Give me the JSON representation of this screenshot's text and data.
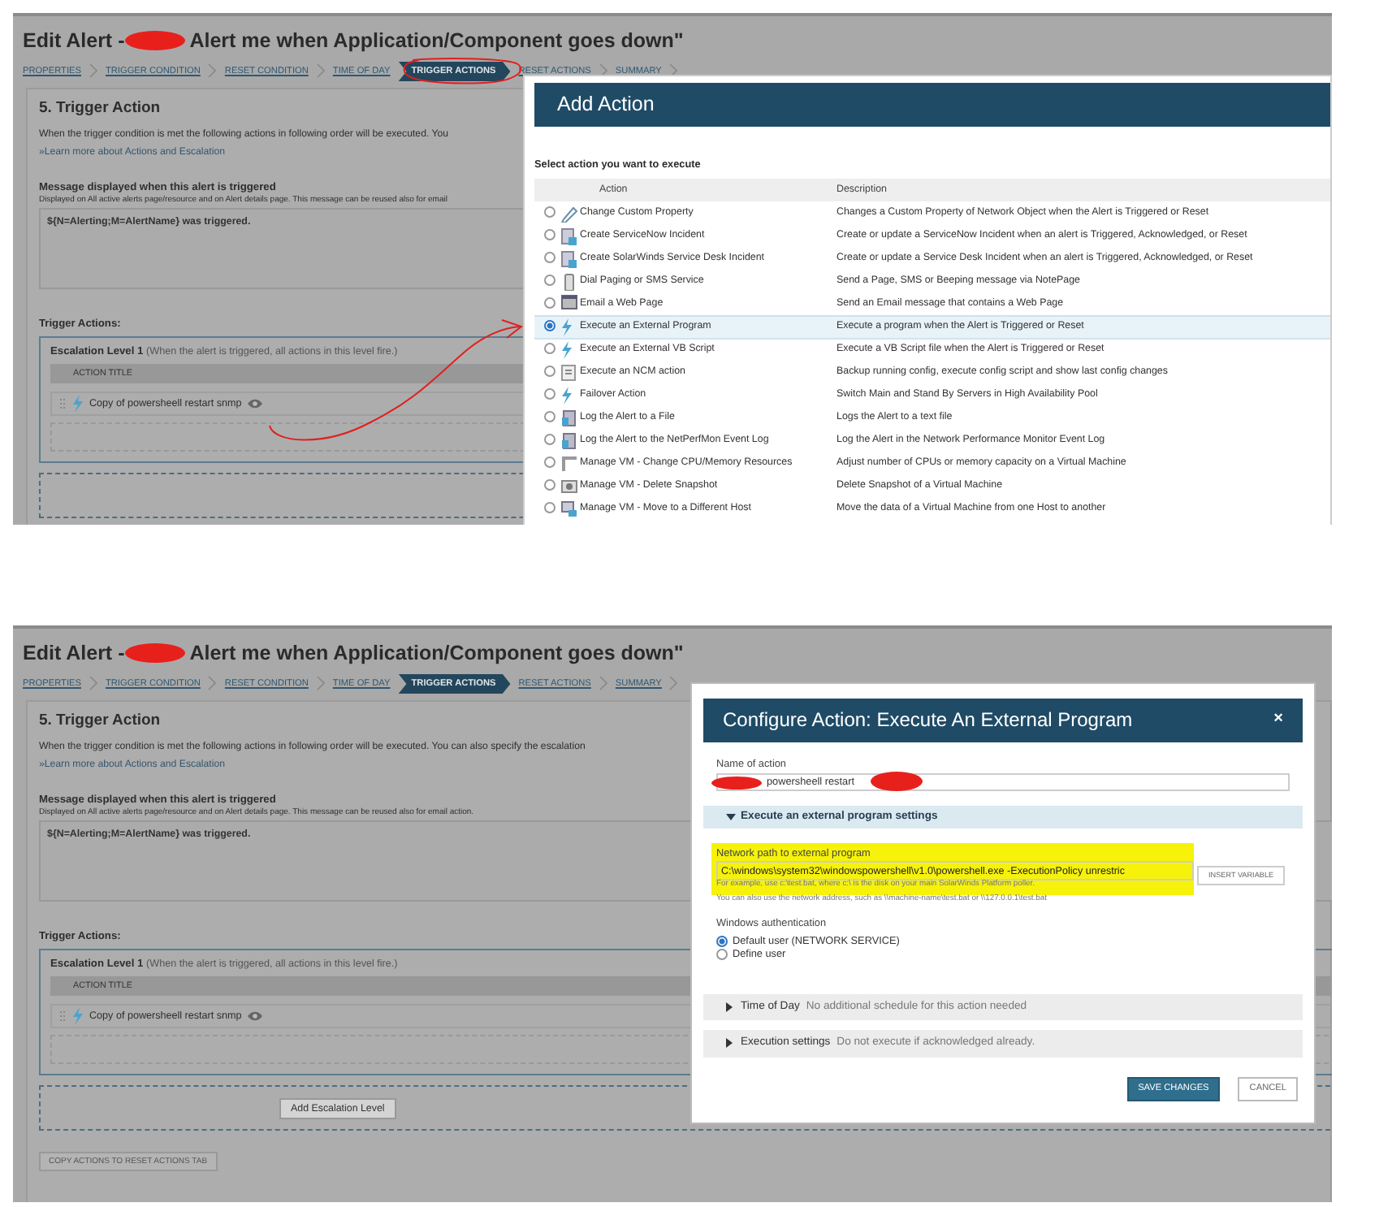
{
  "screens": [
    {
      "title_prefix": "Edit Alert -",
      "title_redacted": true,
      "title": "Alert me when Application/Component goes down\"",
      "steps": [
        {
          "label": "PROPERTIES",
          "selected": false
        },
        {
          "label": "TRIGGER CONDITION",
          "selected": false
        },
        {
          "label": "RESET CONDITION",
          "selected": false
        },
        {
          "label": "TIME OF DAY",
          "selected": false
        },
        {
          "label": "TRIGGER ACTIONS",
          "selected": true
        },
        {
          "label": "RESET ACTIONS",
          "selected": false
        },
        {
          "label": "SUMMARY",
          "selected": false
        }
      ],
      "heading": "5. Trigger Action",
      "intro": "When the trigger condition is met the following actions in following order will be executed. You",
      "learn_more": "»Learn more about Actions and Escalation",
      "message_label": "Message displayed when this alert is triggered",
      "message_hint": "Displayed on All active alerts page/resource and on Alert details page. This message can be reused also for email",
      "message_value": "${N=Alerting;M=AlertName} was triggered.",
      "trigger_actions_label": "Trigger Actions:",
      "escalation": {
        "title": "Escalation Level 1",
        "note": "(When the alert is triggered, all actions in this level fire.)",
        "column": "ACTION TITLE",
        "actions": [
          "Copy of powersheell restart snmp"
        ]
      },
      "dialog": {
        "kind": "add_action",
        "title": "Add Action",
        "prompt": "Select action you want to execute",
        "columns": [
          "Action",
          "Description"
        ],
        "rows": [
          {
            "action": "Change Custom Property",
            "description": "Changes a Custom Property of Network Object when the Alert is Triggered or Reset",
            "selected": false
          },
          {
            "action": "Create ServiceNow Incident",
            "description": "Create or update a ServiceNow Incident when an alert is Triggered, Acknowledged, or Reset",
            "selected": false
          },
          {
            "action": "Create SolarWinds Service Desk Incident",
            "description": "Create or update a Service Desk Incident when an alert is Triggered, Acknowledged, or Reset",
            "selected": false
          },
          {
            "action": "Dial Paging or SMS Service",
            "description": "Send a Page, SMS or Beeping message via NotePage",
            "selected": false
          },
          {
            "action": "Email a Web Page",
            "description": "Send an Email message that contains a Web Page",
            "selected": false
          },
          {
            "action": "Execute an External Program",
            "description": "Execute a program when the Alert is Triggered or Reset",
            "selected": true
          },
          {
            "action": "Execute an External VB Script",
            "description": "Execute a VB Script file when the Alert is Triggered or Reset",
            "selected": false
          },
          {
            "action": "Execute an NCM action",
            "description": "Backup running config, execute config script and show last config changes",
            "selected": false
          },
          {
            "action": "Failover Action",
            "description": "Switch Main and Stand By Servers in High Availability Pool",
            "selected": false
          },
          {
            "action": "Log the Alert to a File",
            "description": "Logs the Alert to a text file",
            "selected": false
          },
          {
            "action": "Log the Alert to the NetPerfMon Event Log",
            "description": "Log the Alert in the Network Performance Monitor Event Log",
            "selected": false
          },
          {
            "action": "Manage VM - Change CPU/Memory Resources",
            "description": "Adjust number of CPUs or memory capacity on a Virtual Machine",
            "selected": false
          },
          {
            "action": "Manage VM - Delete Snapshot",
            "description": "Delete Snapshot of a Virtual Machine",
            "selected": false
          },
          {
            "action": "Manage VM - Move to a Different Host",
            "description": "Move the data of a Virtual Machine from one Host to another",
            "selected": false
          }
        ]
      },
      "circle_annotation": true,
      "arrow_annotation": true
    },
    {
      "title_prefix": "Edit Alert -",
      "title_redacted": true,
      "title": "Alert me when Application/Component goes down\"",
      "steps": [
        {
          "label": "PROPERTIES",
          "selected": false
        },
        {
          "label": "TRIGGER CONDITION",
          "selected": false
        },
        {
          "label": "RESET CONDITION",
          "selected": false
        },
        {
          "label": "TIME OF DAY",
          "selected": false
        },
        {
          "label": "TRIGGER ACTIONS",
          "selected": true
        },
        {
          "label": "RESET ACTIONS",
          "selected": false
        },
        {
          "label": "SUMMARY",
          "selected": false
        }
      ],
      "heading": "5. Trigger Action",
      "intro": "When the trigger condition is met the following actions in following order will be executed. You can also specify the escalation",
      "learn_more": "»Learn more about Actions and Escalation",
      "message_label": "Message displayed when this alert is triggered",
      "message_hint": "Displayed on All active alerts page/resource and on Alert details page. This message can be reused also for email action.",
      "message_value": "${N=Alerting;M=AlertName} was triggered.",
      "trigger_actions_label": "Trigger Actions:",
      "escalation": {
        "title": "Escalation Level 1",
        "note": "(When the alert is triggered, all actions in this level fire.)",
        "column": "ACTION TITLE",
        "actions": [
          "Copy of powersheell restart snmp"
        ]
      },
      "add_escalation_button": "Add Escalation Level",
      "copy_button": "COPY ACTIONS TO RESET ACTIONS TAB",
      "dialog": {
        "kind": "configure_action",
        "title": "Configure Action: Execute An External Program",
        "close": "×",
        "name_label": "Name of action",
        "name_value": "powersheell restart",
        "name_redacted": true,
        "settings": {
          "title": "Execute an external program settings",
          "expanded": true,
          "path_label": "Network path to external program",
          "path_value": "C:\\windows\\system32\\windowspowershell\\v1.0\\powershell.exe -ExecutionPolicy unrestric",
          "path_highlighted": true,
          "insert_button": "INSERT VARIABLE",
          "help": [
            "For example, use c:\\test.bat, where c:\\ is the disk on your main SolarWinds Platform poller.",
            "You can also use the network address, such as \\\\machine-name\\test.bat or \\\\127.0.0.1\\test.bat"
          ],
          "auth_label": "Windows authentication",
          "auth_options": [
            {
              "label": "Default user (NETWORK SERVICE)",
              "selected": true
            },
            {
              "label": "Define user",
              "selected": false
            }
          ]
        },
        "sections": [
          {
            "title": "Time of Day",
            "summary": "No additional schedule for this action needed",
            "expanded": false
          },
          {
            "title": "Execution settings",
            "summary": "Do not execute if acknowledged already.",
            "expanded": false
          }
        ],
        "buttons": [
          {
            "label": "SAVE CHANGES",
            "kind": "primary"
          },
          {
            "label": "CANCEL",
            "kind": "secondary"
          }
        ]
      }
    }
  ]
}
